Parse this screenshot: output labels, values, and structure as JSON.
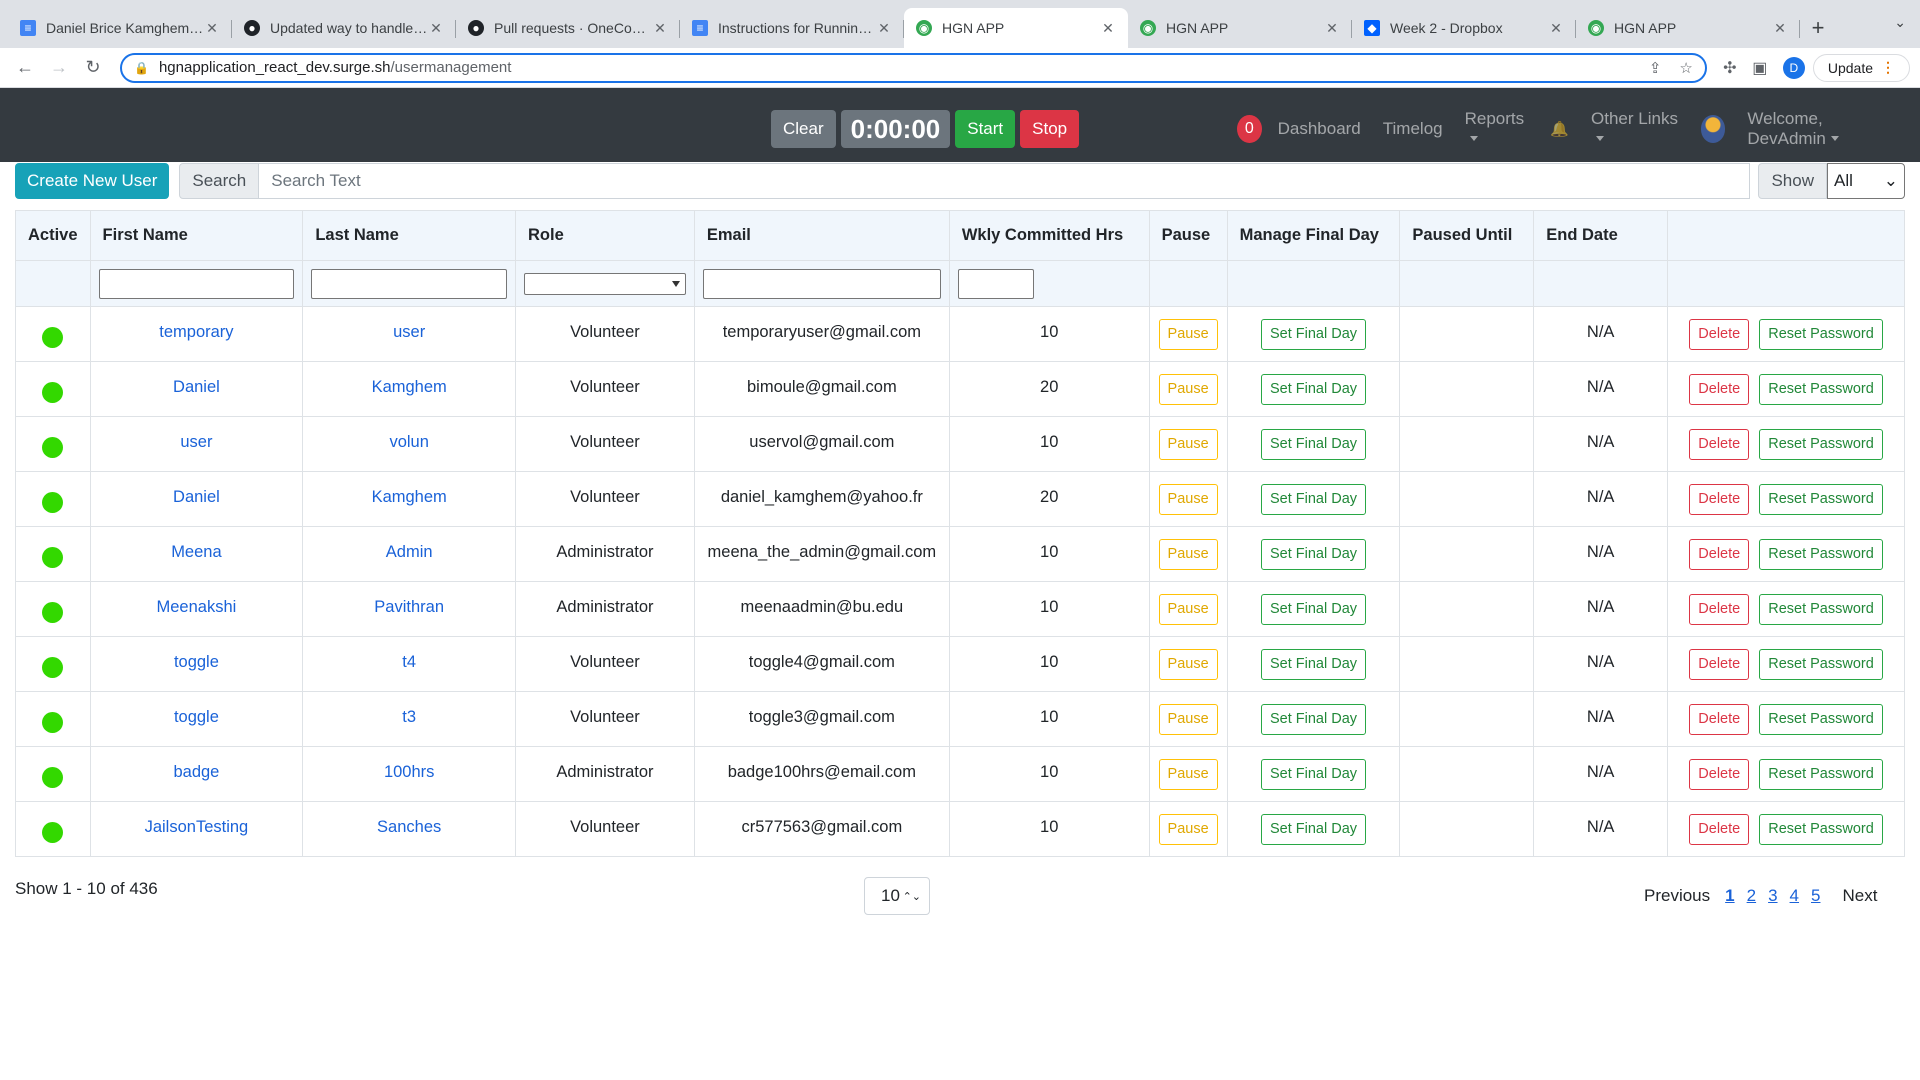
{
  "browser": {
    "tabs": [
      {
        "title": "Daniel Brice Kamghem Kom",
        "icon": "doc-icon",
        "active": false
      },
      {
        "title": "Updated way to handle dupl",
        "icon": "github-icon",
        "active": false
      },
      {
        "title": "Pull requests · OneCommuni",
        "icon": "github-icon",
        "active": false
      },
      {
        "title": "Instructions for Running HGI",
        "icon": "doc-icon",
        "active": false
      },
      {
        "title": "HGN APP",
        "icon": "globe-icon",
        "active": true
      },
      {
        "title": "HGN APP",
        "icon": "globe-icon",
        "active": false
      },
      {
        "title": "Week 2 - Dropbox",
        "icon": "dropbox-icon",
        "active": false
      },
      {
        "title": "HGN APP",
        "icon": "globe-icon",
        "active": false
      }
    ],
    "url_host": "hgnapplication_react_dev.surge.sh",
    "url_path": "/usermanagement",
    "profile_initial": "D",
    "update_label": "Update"
  },
  "navbar": {
    "clear_label": "Clear",
    "timer": "0:00:00",
    "start_label": "Start",
    "stop_label": "Stop",
    "badge_count": "0",
    "links": {
      "dashboard": "Dashboard",
      "timelog": "Timelog",
      "reports": "Reports",
      "other_links": "Other Links",
      "welcome": "Welcome, DevAdmin"
    }
  },
  "toolbar": {
    "create_label": "Create New User",
    "search_label": "Search",
    "search_placeholder": "Search Text",
    "show_label": "Show",
    "show_value": "All"
  },
  "table": {
    "headers": [
      "Active",
      "First Name",
      "Last Name",
      "Role",
      "Email",
      "Wkly Committed Hrs",
      "Pause",
      "Manage Final Day",
      "Paused Until",
      "End Date",
      ""
    ],
    "buttons": {
      "pause": "Pause",
      "final_day": "Set Final Day",
      "delete": "Delete",
      "reset": "Reset Password"
    },
    "rows": [
      {
        "first": "temporary",
        "last": "user",
        "role": "Volunteer",
        "email": "temporaryuser@gmail.com",
        "hrs": "10",
        "paused_until": "",
        "end_date": "N/A"
      },
      {
        "first": "Daniel",
        "last": "Kamghem",
        "role": "Volunteer",
        "email": "bimoule@gmail.com",
        "hrs": "20",
        "paused_until": "",
        "end_date": "N/A"
      },
      {
        "first": "user",
        "last": "volun",
        "role": "Volunteer",
        "email": "uservol@gmail.com",
        "hrs": "10",
        "paused_until": "",
        "end_date": "N/A"
      },
      {
        "first": "Daniel",
        "last": "Kamghem",
        "role": "Volunteer",
        "email": "daniel_kamghem@yahoo.fr",
        "hrs": "20",
        "paused_until": "",
        "end_date": "N/A"
      },
      {
        "first": "Meena",
        "last": "Admin",
        "role": "Administrator",
        "email": "meena_the_admin@gmail.com",
        "hrs": "10",
        "paused_until": "",
        "end_date": "N/A"
      },
      {
        "first": "Meenakshi",
        "last": "Pavithran",
        "role": "Administrator",
        "email": "meenaadmin@bu.edu",
        "hrs": "10",
        "paused_until": "",
        "end_date": "N/A"
      },
      {
        "first": "toggle",
        "last": "t4",
        "role": "Volunteer",
        "email": "toggle4@gmail.com",
        "hrs": "10",
        "paused_until": "",
        "end_date": "N/A"
      },
      {
        "first": "toggle",
        "last": "t3",
        "role": "Volunteer",
        "email": "toggle3@gmail.com",
        "hrs": "10",
        "paused_until": "",
        "end_date": "N/A"
      },
      {
        "first": "badge",
        "last": "100hrs",
        "role": "Administrator",
        "email": "badge100hrs@email.com",
        "hrs": "10",
        "paused_until": "",
        "end_date": "N/A"
      },
      {
        "first": "JailsonTesting",
        "last": "Sanches",
        "role": "Volunteer",
        "email": "cr577563@gmail.com",
        "hrs": "10",
        "paused_until": "",
        "end_date": "N/A"
      }
    ]
  },
  "footer": {
    "count_text": "Show 1 - 10 of 436",
    "page_size": "10",
    "previous_label": "Previous",
    "pages": [
      "1",
      "2",
      "3",
      "4",
      "5"
    ],
    "next_label": "Next"
  },
  "colors": {
    "active_dot": "#33d800",
    "navbar_bg": "#343a40",
    "link": "#1a62d8"
  }
}
